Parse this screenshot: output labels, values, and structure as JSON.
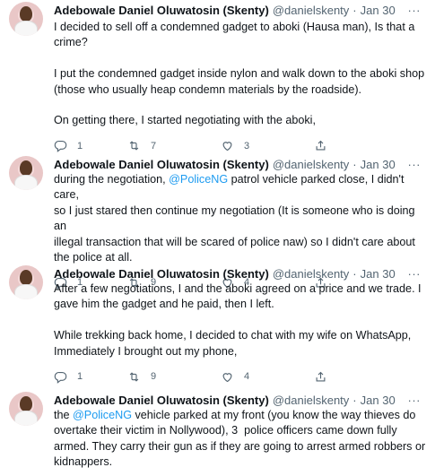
{
  "tweets": [
    {
      "author": {
        "name": "Adebowale Daniel Oluwatosin (Skenty)",
        "handle": "@danielskenty",
        "date": "Jan 30"
      },
      "segments": [
        {
          "text": "I decided to sell off a condemned gadget to aboki (Hausa man), Is that a\ncrime?\n\nI put the condemned gadget inside nylon and walk down to the aboki shop\n(those who usually heap condemn materials by the roadside).\n\nOn getting there, I started negotiating with the aboki,",
          "mention": false
        }
      ],
      "replies": "1",
      "retweets": "7",
      "likes": "3",
      "more": "···"
    },
    {
      "author": {
        "name": "Adebowale Daniel Oluwatosin (Skenty)",
        "handle": "@danielskenty",
        "date": "Jan 30"
      },
      "segments": [
        {
          "text": "during the negotiation, ",
          "mention": false
        },
        {
          "text": "@PoliceNG",
          "mention": true
        },
        {
          "text": " patrol vehicle parked close, I didn't care,\nso I just stared then continue my negotiation (It is someone who is doing an\nillegal transaction that will be scared of police naw) so I didn't care about\nthe police at all.",
          "mention": false
        }
      ],
      "replies": "1",
      "retweets": "9",
      "likes": "4",
      "more": "···"
    },
    {
      "author": {
        "name": "Adebowale Daniel Oluwatosin (Skenty)",
        "handle": "@danielskenty",
        "date": "Jan 30"
      },
      "segments": [
        {
          "text": "After a few negotiations, I and the aboki agreed on a price and we trade. I\ngave him the gadget and he paid, then I left.\n\nWhile trekking back home, I decided to chat with my wife on WhatsApp,\nImmediately I brought out my phone,",
          "mention": false
        }
      ],
      "replies": "1",
      "retweets": "9",
      "likes": "4",
      "more": "···"
    },
    {
      "author": {
        "name": "Adebowale Daniel Oluwatosin (Skenty)",
        "handle": "@danielskenty",
        "date": "Jan 30"
      },
      "segments": [
        {
          "text": "the ",
          "mention": false
        },
        {
          "text": "@PoliceNG",
          "mention": true
        },
        {
          "text": " vehicle parked at my front (you know the way thieves do\novertake their victim in Nollywood), 3  police officers came down fully\narmed. They carry their gun as if they are going to arrest armed robbers or\nkidnappers.",
          "mention": false
        }
      ],
      "more": "···"
    }
  ],
  "colors": {
    "accent": "#1d9bf0",
    "muted": "#536471",
    "text": "#0f1419"
  },
  "icons": {
    "reply": "reply-icon",
    "retweet": "retweet-icon",
    "like": "heart-icon",
    "share": "share-icon",
    "more": "more-icon"
  }
}
